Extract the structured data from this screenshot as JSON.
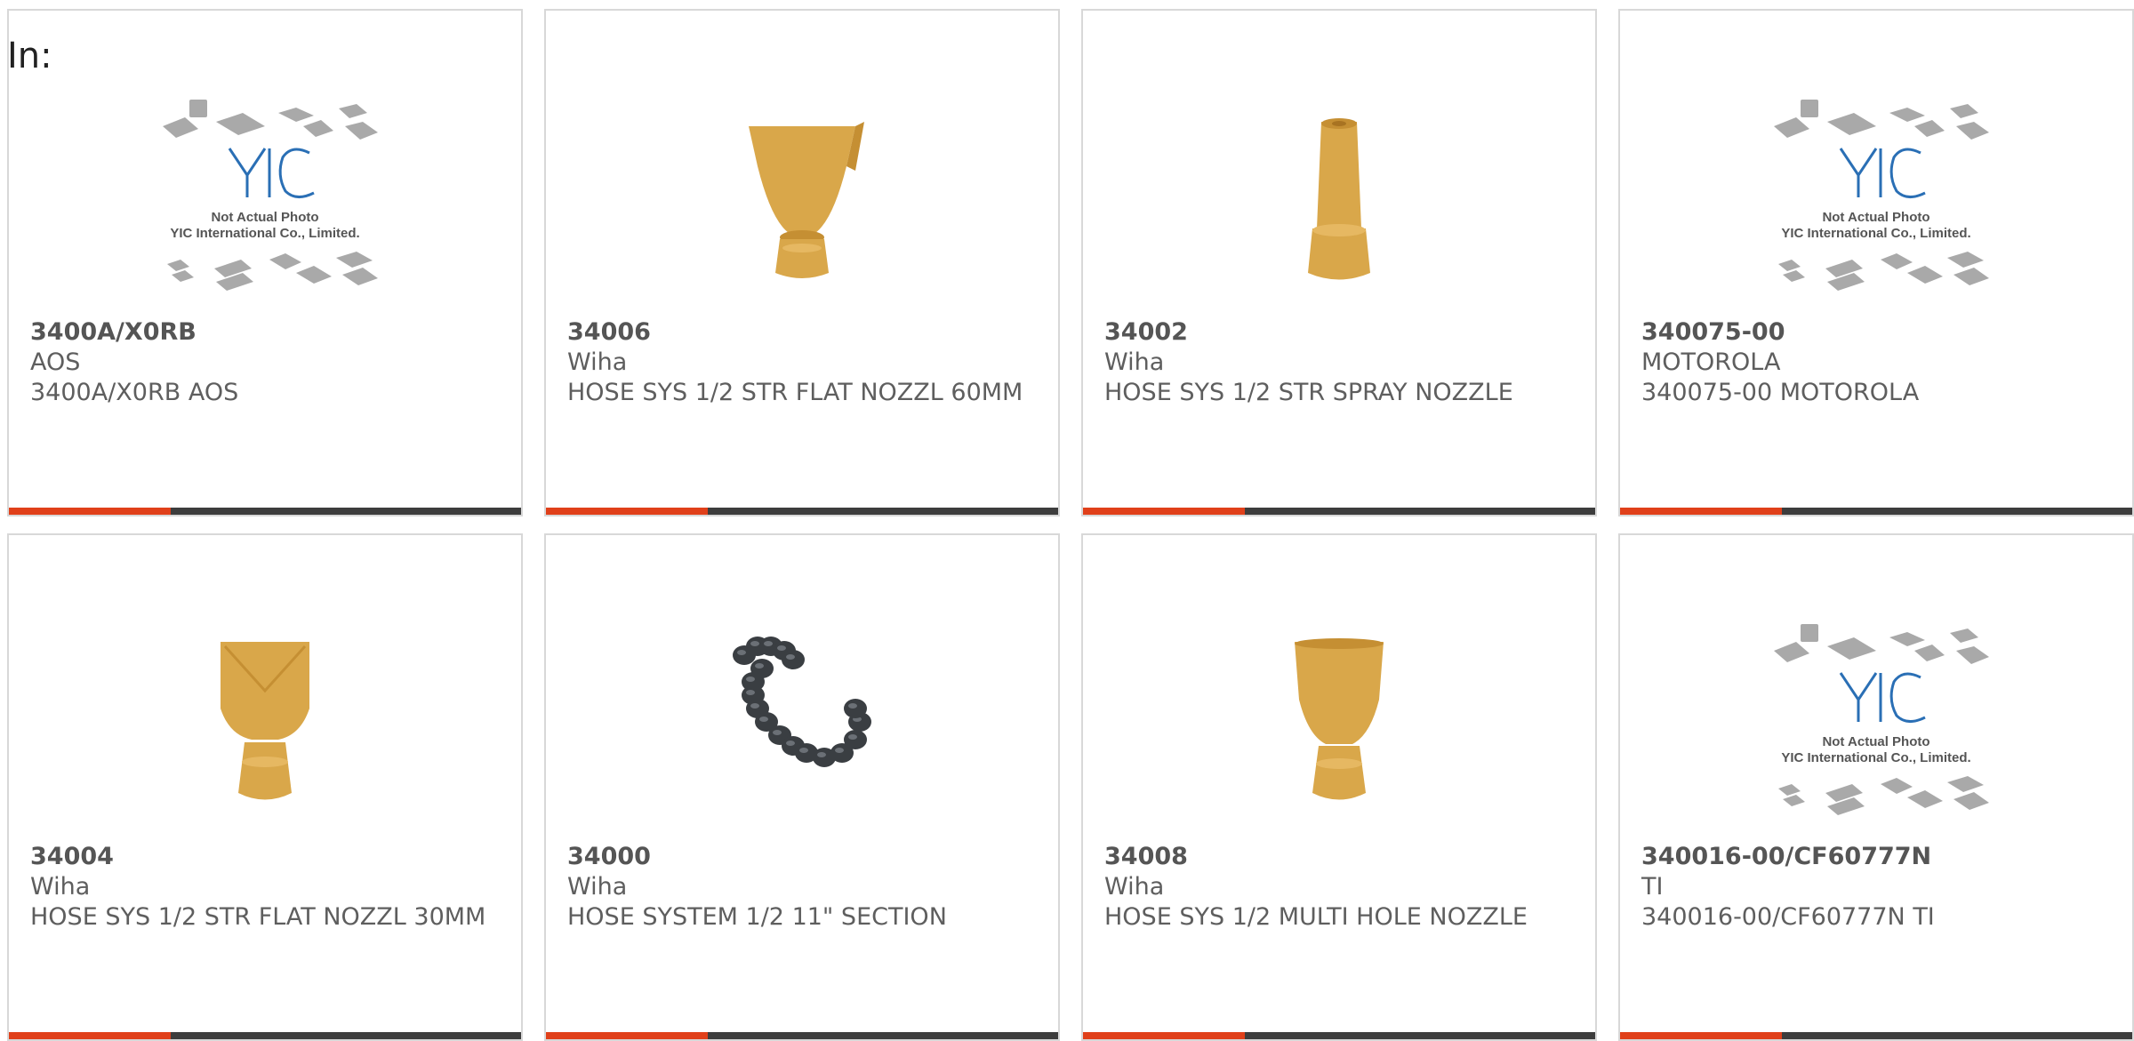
{
  "header": {
    "label": "In:"
  },
  "colors": {
    "accent": "#e0401a",
    "bar": "#3d3d3d",
    "text": "#5e5e5e",
    "border": "#d8d8d8"
  },
  "placeholder": {
    "line1": "Not Actual Photo",
    "line2": "YIC International Co., Limited.",
    "logo_text": "YIC"
  },
  "products": [
    {
      "part": "3400A/X0RB",
      "manufacturer": "AOS",
      "description": "3400A/X0RB AOS",
      "image": "placeholder-logo"
    },
    {
      "part": "34006",
      "manufacturer": "Wiha",
      "description": "HOSE SYS 1/2 STR FLAT NOZZL 60MM",
      "image": "wide-flat-nozzle"
    },
    {
      "part": "34002",
      "manufacturer": "Wiha",
      "description": "HOSE SYS 1/2 STR SPRAY NOZZLE",
      "image": "spray-nozzle"
    },
    {
      "part": "340075-00",
      "manufacturer": "MOTOROLA",
      "description": "340075-00 MOTOROLA",
      "image": "placeholder-logo"
    },
    {
      "part": "34004",
      "manufacturer": "Wiha",
      "description": "HOSE SYS 1/2 STR FLAT NOZZL 30MM",
      "image": "flat-nozzle"
    },
    {
      "part": "34000",
      "manufacturer": "Wiha",
      "description": "HOSE SYSTEM 1/2 11\" SECTION",
      "image": "hose-section"
    },
    {
      "part": "34008",
      "manufacturer": "Wiha",
      "description": "HOSE SYS 1/2 MULTI HOLE NOZZLE",
      "image": "multi-hole-nozzle"
    },
    {
      "part": "340016-00/CF60777N",
      "manufacturer": "TI",
      "description": "340016-00/CF60777N TI",
      "image": "placeholder-logo"
    }
  ]
}
